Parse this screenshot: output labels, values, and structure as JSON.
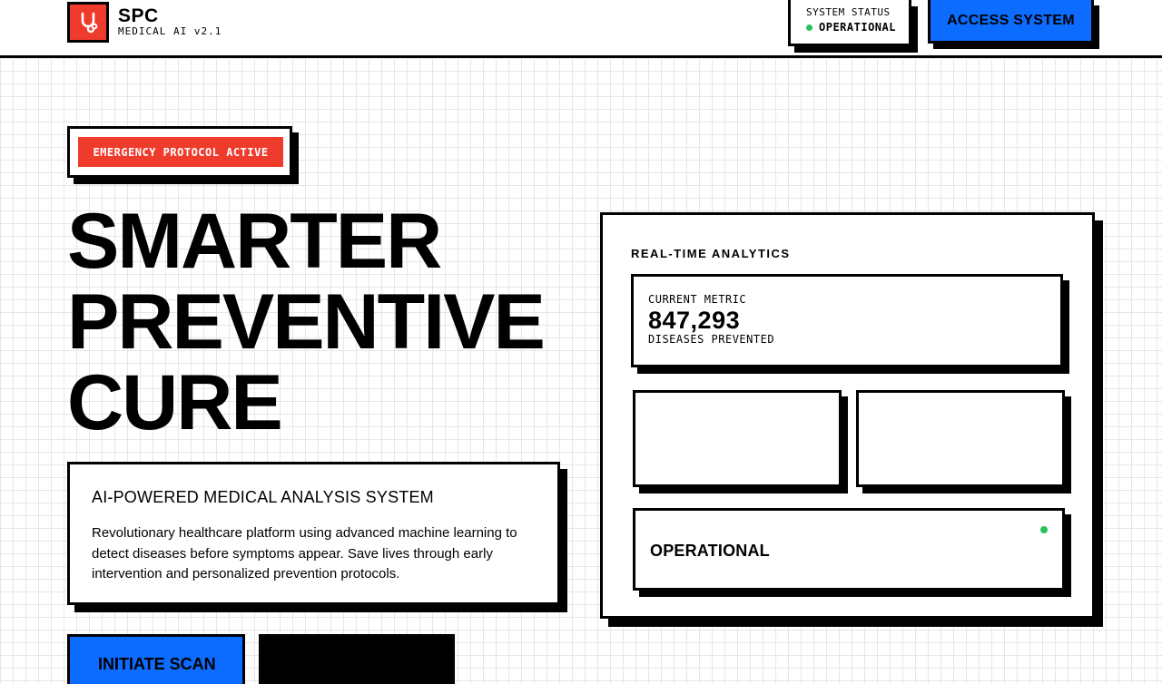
{
  "header": {
    "brand_name": "SPC",
    "brand_sub": "MEDICAL AI v2.1",
    "logo_icon": "stethoscope-icon",
    "status_label": "SYSTEM STATUS",
    "status_value": "OPERATIONAL",
    "access_label": "ACCESS SYSTEM"
  },
  "hero": {
    "badge": "EMERGENCY PROTOCOL ACTIVE",
    "line1": "SMARTER",
    "line2": "PREVENTIVE",
    "line3": "CURE"
  },
  "description": {
    "title": "AI-POWERED MEDICAL ANALYSIS SYSTEM",
    "body": "Revolutionary healthcare platform using advanced machine learning to detect diseases before symptoms appear. Save lives through early intervention and personalized prevention protocols."
  },
  "actions": {
    "scan_label": "INITIATE SCAN",
    "scan_arrow": "→"
  },
  "analytics": {
    "title": "REAL-TIME ANALYTICS",
    "metric_label": "CURRENT METRIC",
    "metric_value": "847,293",
    "metric_sub": "DISEASES PREVENTED",
    "op_label": "OPERATIONAL"
  },
  "colors": {
    "accent_red": "#ef3b2c",
    "accent_blue": "#0b6cff",
    "status_green": "#2bc25a"
  }
}
